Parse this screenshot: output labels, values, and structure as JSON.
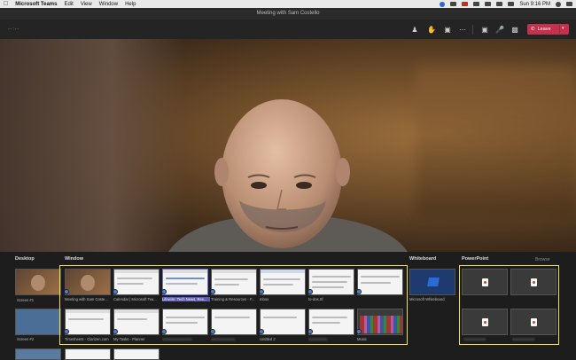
{
  "menubar": {
    "apple": "",
    "app_name": "Microsoft Teams",
    "menus": [
      "Edit",
      "View",
      "Window",
      "Help"
    ],
    "clock": "Sun 9:16 PM"
  },
  "window": {
    "title": "Meeting with Sam Costello"
  },
  "toolbar": {
    "timer": "--:--",
    "leave_label": "Leave"
  },
  "tray": {
    "desktop_title": "Desktop",
    "window_title": "Window",
    "whiteboard_title": "Whiteboard",
    "powerpoint_title": "PowerPoint",
    "browse_label": "Browse",
    "desktop_screens": [
      "Screen #1",
      "Screen #2"
    ],
    "windows": [
      "Meeting with Sam Coste...",
      "Calendar | Microsoft Tea...",
      "Lifewire: Tech News, Rev...",
      "Training & Resources - F...",
      "Inbox",
      "to-dos.rtf",
      "Timesheets - Clarizen.com",
      "My Tasks - Planner",
      "",
      "",
      "Untitled 2",
      "",
      "Music"
    ],
    "whiteboard_label": "Microsoft Whiteboard"
  },
  "colors": {
    "leave": "#c4314b",
    "highlight": "#f2e14a",
    "accent": "#4a7fd4"
  }
}
